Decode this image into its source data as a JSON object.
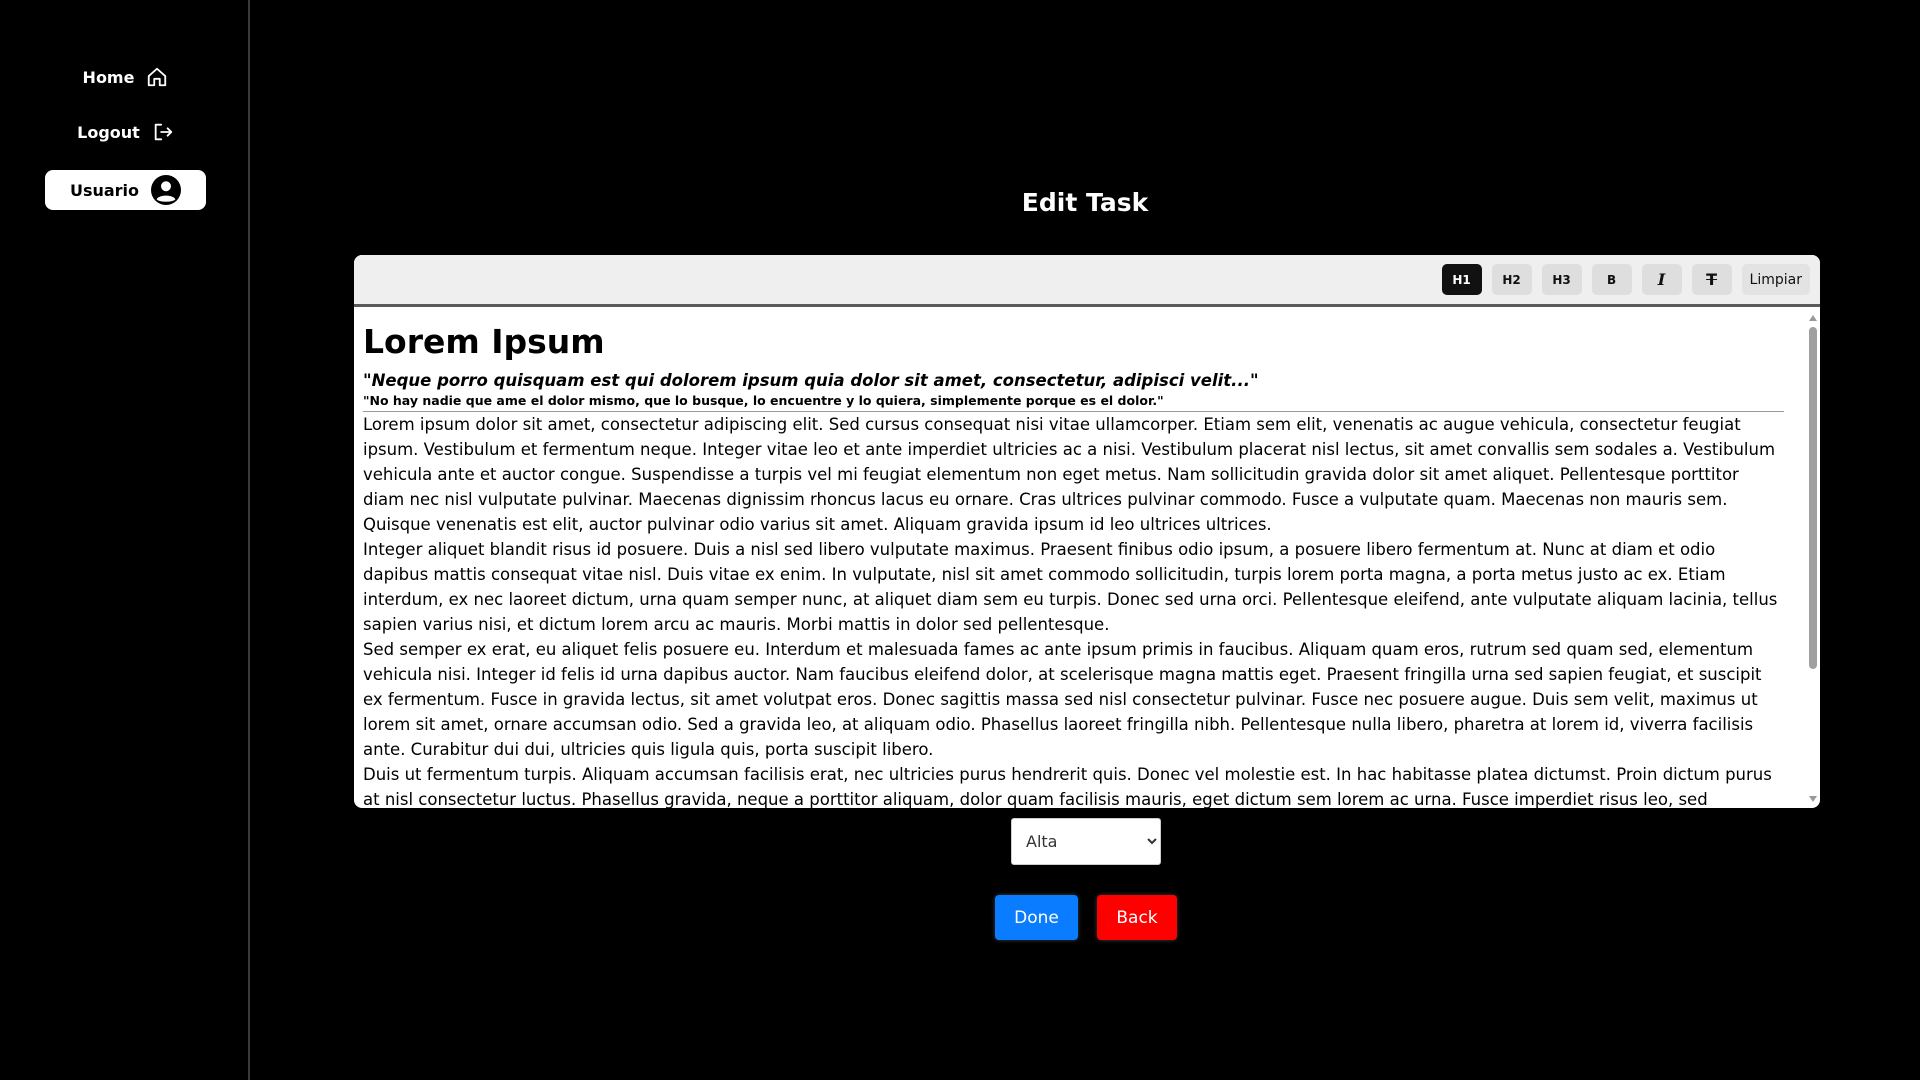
{
  "sidebar": {
    "home_label": "Home",
    "logout_label": "Logout",
    "user_label": "Usuario"
  },
  "page": {
    "title": "Edit Task"
  },
  "toolbar": {
    "h1": "H1",
    "h2": "H2",
    "h3": "H3",
    "bold": "B",
    "italic": "I",
    "strike": "T",
    "clear": "Limpiar",
    "active": "H1"
  },
  "content": {
    "heading": "Lorem Ipsum",
    "quote": "\"Neque porro quisquam est qui dolorem ipsum quia dolor sit amet, consectetur, adipisci velit...\"",
    "subquote": "\"No hay nadie que ame el dolor mismo, que lo busque, lo encuentre y lo quiera, simplemente porque es el dolor.\"",
    "paragraphs": [
      "Lorem ipsum dolor sit amet, consectetur adipiscing elit. Sed cursus consequat nisi vitae ullamcorper. Etiam sem elit, venenatis ac augue vehicula, consectetur feugiat ipsum. Vestibulum et fermentum neque. Integer vitae leo et ante imperdiet ultricies ac a nisi. Vestibulum placerat nisl lectus, sit amet convallis sem sodales a. Vestibulum vehicula ante et auctor congue. Suspendisse a turpis vel mi feugiat elementum non eget metus. Nam sollicitudin gravida dolor sit amet aliquet. Pellentesque porttitor diam nec nisl vulputate pulvinar. Maecenas dignissim rhoncus lacus eu ornare. Cras ultrices pulvinar commodo. Fusce a vulputate quam. Maecenas non mauris sem. Quisque venenatis est elit, auctor pulvinar odio varius sit amet. Aliquam gravida ipsum id leo ultrices ultrices.",
      "Integer aliquet blandit risus id posuere. Duis a nisl sed libero vulputate maximus. Praesent finibus odio ipsum, a posuere libero fermentum at. Nunc at diam et odio dapibus mattis consequat vitae nisl. Duis vitae ex enim. In vulputate, nisl sit amet commodo sollicitudin, turpis lorem porta magna, a porta metus justo ac ex. Etiam interdum, ex nec laoreet dictum, urna quam semper nunc, at aliquet diam sem eu turpis. Donec sed urna orci. Pellentesque eleifend, ante vulputate aliquam lacinia, tellus sapien varius nisi, et dictum lorem arcu ac mauris. Morbi mattis in dolor sed pellentesque.",
      "Sed semper ex erat, eu aliquet felis posuere eu. Interdum et malesuada fames ac ante ipsum primis in faucibus. Aliquam quam eros, rutrum sed quam sed, elementum vehicula nisi. Integer id felis id urna dapibus auctor. Nam faucibus eleifend dolor, at scelerisque magna mattis eget. Praesent fringilla urna sed sapien feugiat, et suscipit ex fermentum. Fusce in gravida lectus, sit amet volutpat eros. Donec sagittis massa sed nisl consectetur pulvinar. Fusce nec posuere augue. Duis sem velit, maximus ut lorem sit amet, ornare accumsan odio. Sed a gravida leo, at aliquam odio. Phasellus laoreet fringilla nibh. Pellentesque nulla libero, pharetra at lorem id, viverra facilisis ante. Curabitur dui dui, ultricies quis ligula quis, porta suscipit libero.",
      "Duis ut fermentum turpis. Aliquam accumsan facilisis erat, nec ultricies purus hendrerit quis. Donec vel molestie est. In hac habitasse platea dictumst. Proin dictum purus at nisl consectetur luctus. Phasellus gravida, neque a porttitor aliquam, dolor quam facilisis mauris, eget dictum sem lorem ac urna. Fusce imperdiet risus leo, sed malesuada urna"
    ]
  },
  "priority": {
    "selected": "Alta"
  },
  "actions": {
    "done_label": "Done",
    "back_label": "Back"
  },
  "colors": {
    "background": "#000000",
    "done": "#0a7cff",
    "back": "#ff0000"
  }
}
